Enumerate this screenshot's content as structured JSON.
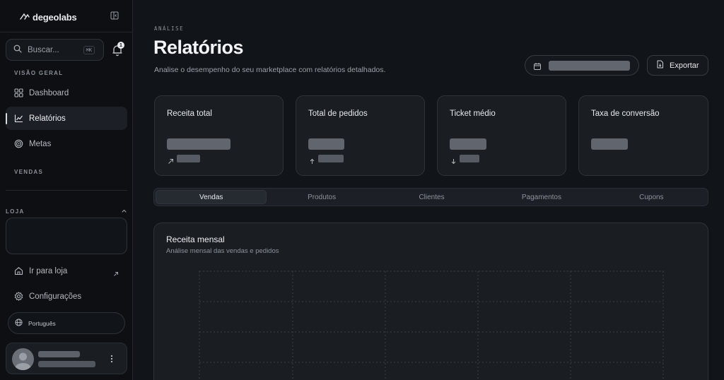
{
  "sidebar": {
    "brand": "degeolabs",
    "search": {
      "placeholder": "Buscar...",
      "shortcut": "⌘K"
    },
    "notifications": {
      "count": "1"
    },
    "sections": {
      "overview": "VISÃO GERAL",
      "sales": "VENDAS",
      "store": "LOJA"
    },
    "nav": [
      {
        "label": "Dashboard",
        "icon": "grid-icon"
      },
      {
        "label": "Relatórios",
        "icon": "chart-line-icon",
        "active": true
      },
      {
        "label": "Metas",
        "icon": "target-icon"
      }
    ],
    "footer_nav": [
      {
        "label": "Ir para loja",
        "icon": "home-icon"
      },
      {
        "label": "Configurações",
        "icon": "gear-icon"
      }
    ],
    "language": "Português"
  },
  "header": {
    "eyebrow": "ANÁLISE",
    "title": "Relatórios",
    "subtitle": "Analise o desempenho do seu marketplace com relatórios detalhados.",
    "export_label": "Exportar"
  },
  "kpis": [
    {
      "label": "Receita total",
      "trend": "up-right-arrow-icon"
    },
    {
      "label": "Total de pedidos",
      "trend": "up-arrow-icon"
    },
    {
      "label": "Ticket médio",
      "trend": "down-arrow-icon"
    },
    {
      "label": "Taxa de conversão"
    }
  ],
  "tabs": [
    {
      "label": "Vendas",
      "active": true
    },
    {
      "label": "Produtos"
    },
    {
      "label": "Clientes"
    },
    {
      "label": "Pagamentos"
    },
    {
      "label": "Cupons"
    }
  ],
  "chart": {
    "title": "Receita mensal",
    "subtitle": "Análise mensal das vendas e pedidos"
  },
  "colors": {
    "background": "#111418",
    "sidebar": "#0d0f12",
    "card": "#1a1e23",
    "border": "#2e333a",
    "text": "#e6e8eb",
    "muted": "#8a9099"
  }
}
